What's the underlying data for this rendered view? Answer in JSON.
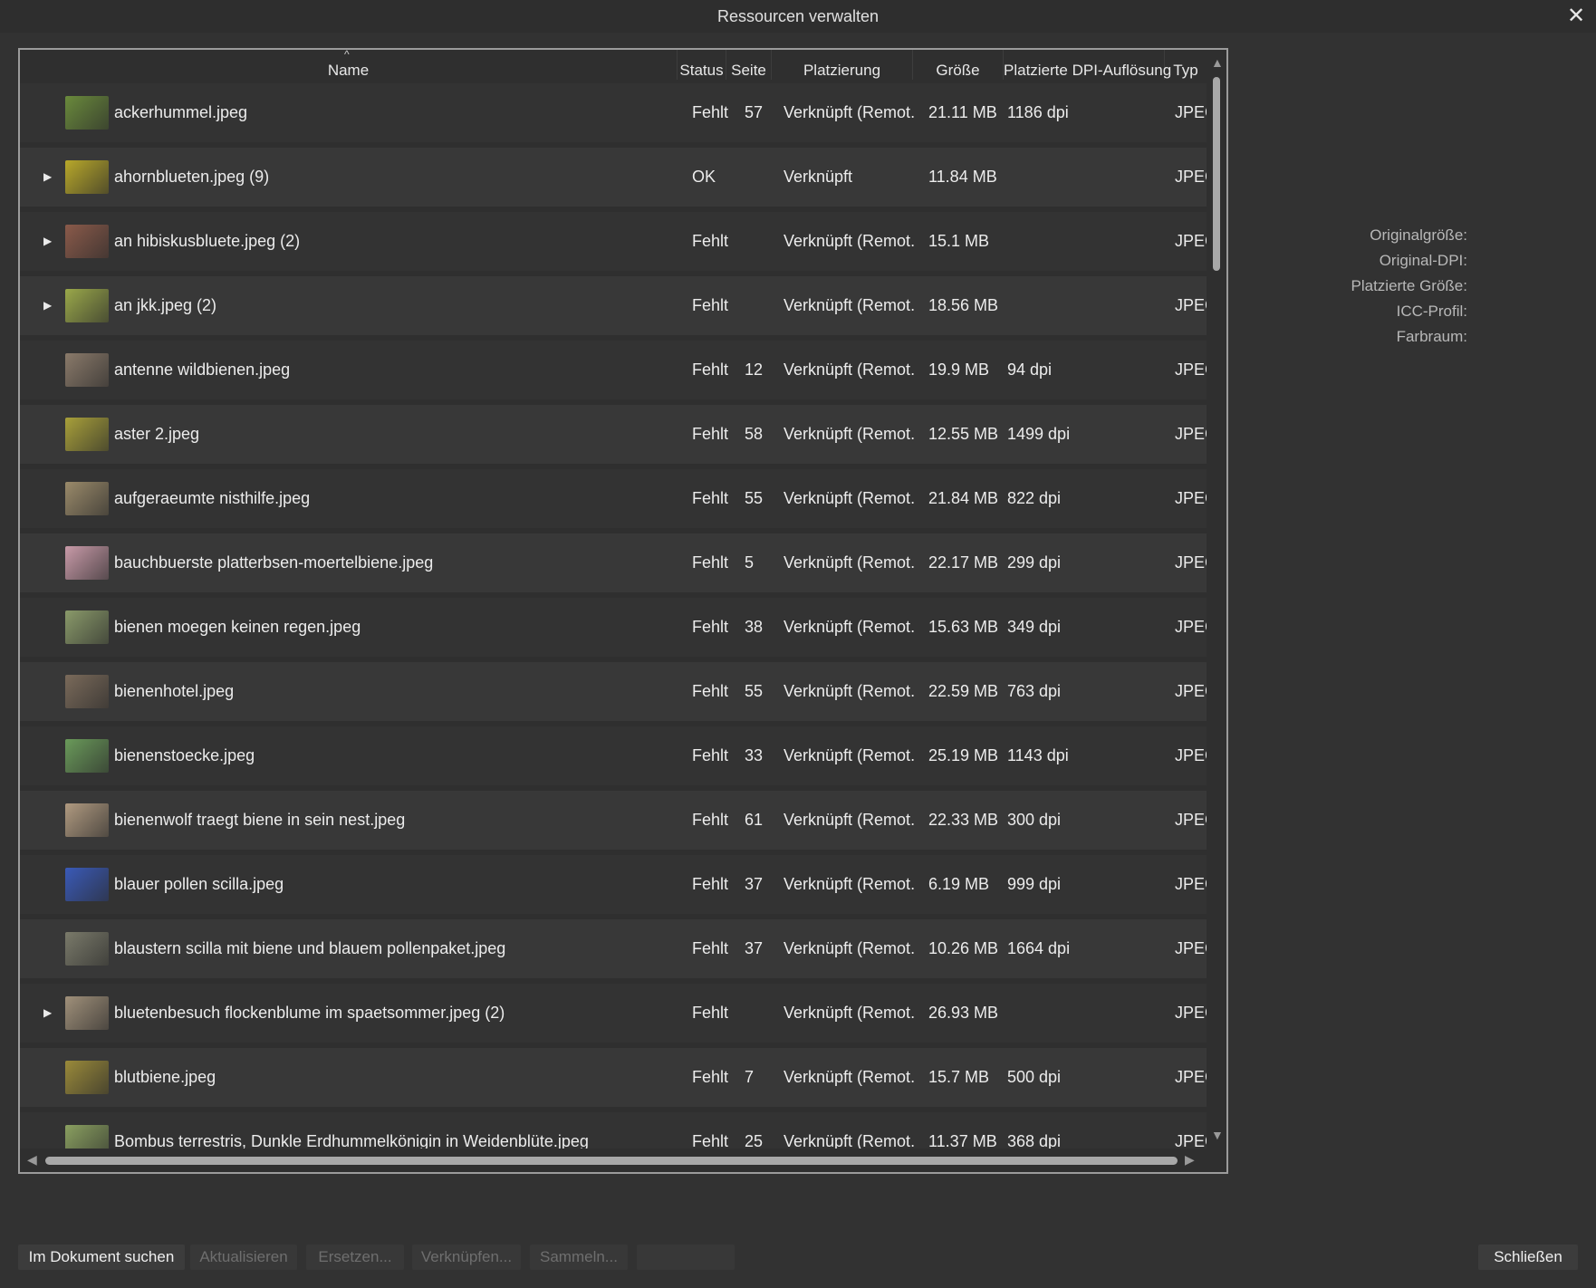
{
  "window": {
    "title": "Ressourcen verwalten"
  },
  "table": {
    "columns": {
      "name": "Name",
      "status": "Status",
      "page": "Seite",
      "placement": "Platzierung",
      "size": "Größe",
      "dpi": "Platzierte DPI-Auflösung",
      "type": "Typ"
    },
    "rows": [
      {
        "name": "ackerhummel.jpeg",
        "expand": false,
        "status": "Fehlt",
        "page": "57",
        "placement": "Verknüpft (Remot...",
        "size": "21.11 MB",
        "dpi": "1186 dpi",
        "type": "JPEG",
        "thumb": "#6a8a3c"
      },
      {
        "name": "ahornblueten.jpeg (9)",
        "expand": true,
        "status": "OK",
        "page": "",
        "placement": "Verknüpft",
        "size": "11.84 MB",
        "dpi": "",
        "type": "JPEG",
        "thumb": "#b8a82a"
      },
      {
        "name": "an hibiskusbluete.jpeg (2)",
        "expand": true,
        "status": "Fehlt",
        "page": "",
        "placement": "Verknüpft (Remot...",
        "size": "15.1 MB",
        "dpi": "",
        "type": "JPEG",
        "thumb": "#8a5a4a"
      },
      {
        "name": "an jkk.jpeg (2)",
        "expand": true,
        "status": "Fehlt",
        "page": "",
        "placement": "Verknüpft (Remot...",
        "size": "18.56 MB",
        "dpi": "",
        "type": "JPEG",
        "thumb": "#9aa84a"
      },
      {
        "name": "antenne wildbienen.jpeg",
        "expand": false,
        "status": "Fehlt",
        "page": "12",
        "placement": "Verknüpft (Remot...",
        "size": "19.9 MB",
        "dpi": "94 dpi",
        "type": "JPEG",
        "thumb": "#8a7a6a"
      },
      {
        "name": "aster 2.jpeg",
        "expand": false,
        "status": "Fehlt",
        "page": "58",
        "placement": "Verknüpft (Remot...",
        "size": "12.55 MB",
        "dpi": "1499 dpi",
        "type": "JPEG",
        "thumb": "#a8a03a"
      },
      {
        "name": "aufgeraeumte nisthilfe.jpeg",
        "expand": false,
        "status": "Fehlt",
        "page": "55",
        "placement": "Verknüpft (Remot...",
        "size": "21.84 MB",
        "dpi": "822 dpi",
        "type": "JPEG",
        "thumb": "#9a8a6a"
      },
      {
        "name": "bauchbuerste platterbsen-moertelbiene.jpeg",
        "expand": false,
        "status": "Fehlt",
        "page": "5",
        "placement": "Verknüpft (Remot...",
        "size": "22.17 MB",
        "dpi": "299 dpi",
        "type": "JPEG",
        "thumb": "#c89aa8"
      },
      {
        "name": "bienen moegen keinen regen.jpeg",
        "expand": false,
        "status": "Fehlt",
        "page": "38",
        "placement": "Verknüpft (Remot...",
        "size": "15.63 MB",
        "dpi": "349 dpi",
        "type": "JPEG",
        "thumb": "#8a9a6a"
      },
      {
        "name": "bienenhotel.jpeg",
        "expand": false,
        "status": "Fehlt",
        "page": "55",
        "placement": "Verknüpft (Remot...",
        "size": "22.59 MB",
        "dpi": "763 dpi",
        "type": "JPEG",
        "thumb": "#7a6a5a"
      },
      {
        "name": "bienenstoecke.jpeg",
        "expand": false,
        "status": "Fehlt",
        "page": "33",
        "placement": "Verknüpft (Remot...",
        "size": "25.19 MB",
        "dpi": "1143 dpi",
        "type": "JPEG",
        "thumb": "#6a9a5a"
      },
      {
        "name": "bienenwolf traegt biene in sein nest.jpeg",
        "expand": false,
        "status": "Fehlt",
        "page": "61",
        "placement": "Verknüpft (Remot...",
        "size": "22.33 MB",
        "dpi": "300 dpi",
        "type": "JPEG",
        "thumb": "#b09a80"
      },
      {
        "name": "blauer pollen scilla.jpeg",
        "expand": false,
        "status": "Fehlt",
        "page": "37",
        "placement": "Verknüpft (Remot...",
        "size": "6.19 MB",
        "dpi": "999 dpi",
        "type": "JPEG",
        "thumb": "#3a5ab8"
      },
      {
        "name": "blaustern scilla mit biene und blauem pollenpaket.jpeg",
        "expand": false,
        "status": "Fehlt",
        "page": "37",
        "placement": "Verknüpft (Remot...",
        "size": "10.26 MB",
        "dpi": "1664 dpi",
        "type": "JPEG",
        "thumb": "#7a7a6a"
      },
      {
        "name": "bluetenbesuch flockenblume im spaetsommer.jpeg (2)",
        "expand": true,
        "status": "Fehlt",
        "page": "",
        "placement": "Verknüpft (Remot...",
        "size": "26.93 MB",
        "dpi": "",
        "type": "JPEG",
        "thumb": "#a0907a"
      },
      {
        "name": "blutbiene.jpeg",
        "expand": false,
        "status": "Fehlt",
        "page": "7",
        "placement": "Verknüpft (Remot...",
        "size": "15.7 MB",
        "dpi": "500 dpi",
        "type": "JPEG",
        "thumb": "#9a8a3a"
      },
      {
        "name": "Bombus terrestris, Dunkle Erdhummelkönigin in Weidenblüte.jpeg",
        "expand": false,
        "status": "Fehlt",
        "page": "25",
        "placement": "Verknüpft (Remot...",
        "size": "11.37 MB",
        "dpi": "368 dpi",
        "type": "JPEG",
        "thumb": "#8aa060"
      }
    ]
  },
  "details": {
    "original_size": "Originalgröße:",
    "original_dpi": "Original-DPI:",
    "placed_size": "Platzierte Größe:",
    "icc_profile": "ICC-Profil:",
    "color_space": "Farbraum:"
  },
  "buttons": {
    "find": "Im Dokument suchen",
    "update": "Aktualisieren",
    "replace": "Ersetzen...",
    "link": "Verknüpfen...",
    "collect": "Sammeln...",
    "blank": "",
    "close": "Schließen"
  }
}
